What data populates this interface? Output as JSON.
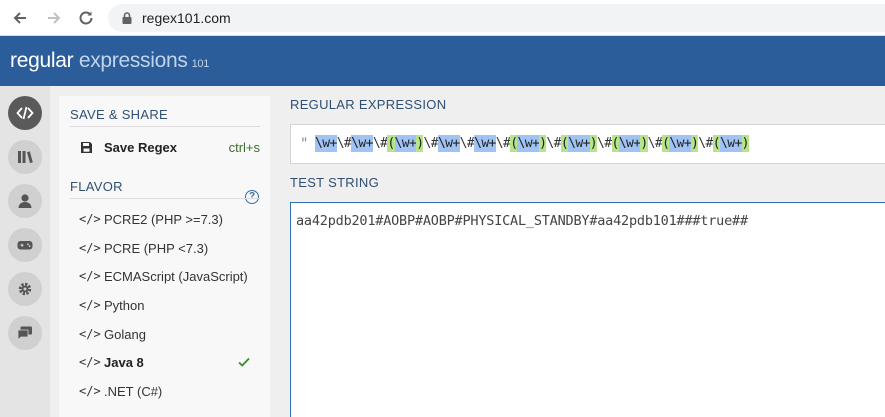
{
  "browser": {
    "url": "regex101.com"
  },
  "header": {
    "logo_word1": "regular",
    "logo_word2": "expressions",
    "logo_version": "101"
  },
  "rail": {
    "items": [
      {
        "icon": "code-icon",
        "active": true
      },
      {
        "icon": "library-icon",
        "active": false
      },
      {
        "icon": "user-icon",
        "active": false
      },
      {
        "icon": "gamepad-icon",
        "active": false
      },
      {
        "icon": "gear-icon",
        "active": false
      },
      {
        "icon": "chat-icon",
        "active": false
      }
    ]
  },
  "side_panel": {
    "save_share_title": "SAVE & SHARE",
    "save_regex_label": "Save Regex",
    "save_regex_shortcut": "ctrl+s",
    "flavor_title": "FLAVOR",
    "help_label": "?",
    "flavors": [
      {
        "icon": "</>",
        "label": "PCRE2 (PHP >=7.3)",
        "selected": false
      },
      {
        "icon": "</>",
        "label": "PCRE (PHP <7.3)",
        "selected": false
      },
      {
        "icon": "</>",
        "label": "ECMAScript (JavaScript)",
        "selected": false
      },
      {
        "icon": "</>",
        "label": "Python",
        "selected": false
      },
      {
        "icon": "</>",
        "label": "Golang",
        "selected": false
      },
      {
        "icon": "</>",
        "label": "Java 8",
        "selected": true
      },
      {
        "icon": "</>",
        "label": ".NET (C#)",
        "selected": false
      }
    ]
  },
  "main": {
    "regex_title": "REGULAR EXPRESSION",
    "delimiter": "\"",
    "regex_tokens": [
      {
        "t": "\\w+",
        "k": "w"
      },
      {
        "t": "\\#",
        "k": "e"
      },
      {
        "t": "\\w+",
        "k": "w"
      },
      {
        "t": "\\#",
        "k": "e"
      },
      {
        "t": "(",
        "k": "g"
      },
      {
        "t": "\\w+",
        "k": "w"
      },
      {
        "t": ")",
        "k": "g"
      },
      {
        "t": "\\#",
        "k": "e"
      },
      {
        "t": "\\w+",
        "k": "w"
      },
      {
        "t": "\\#",
        "k": "e"
      },
      {
        "t": "\\w+",
        "k": "w"
      },
      {
        "t": "\\#",
        "k": "e"
      },
      {
        "t": "(",
        "k": "g"
      },
      {
        "t": "\\w+",
        "k": "w"
      },
      {
        "t": ")",
        "k": "g"
      },
      {
        "t": "\\#",
        "k": "e"
      },
      {
        "t": "(",
        "k": "g"
      },
      {
        "t": "\\w+",
        "k": "w"
      },
      {
        "t": ")",
        "k": "g"
      },
      {
        "t": "\\#",
        "k": "e"
      },
      {
        "t": "(",
        "k": "g"
      },
      {
        "t": "\\w+",
        "k": "w"
      },
      {
        "t": ")",
        "k": "g"
      },
      {
        "t": "\\#",
        "k": "e"
      },
      {
        "t": "(",
        "k": "g"
      },
      {
        "t": "\\w+",
        "k": "w"
      },
      {
        "t": ")",
        "k": "g"
      },
      {
        "t": "\\#",
        "k": "e"
      },
      {
        "t": "(",
        "k": "g"
      },
      {
        "t": "\\w+",
        "k": "w"
      },
      {
        "t": ")",
        "k": "g"
      }
    ],
    "test_title": "TEST STRING",
    "test_string": "aa42pdb201#AOBP#AOBP#PHYSICAL_STANDBY#aa42pdb101###true##"
  },
  "colors": {
    "header_bg": "#2a5d99",
    "token_w": "#9fc3f2",
    "token_group": "#b7e38a",
    "accent": "#2a6fb8"
  }
}
